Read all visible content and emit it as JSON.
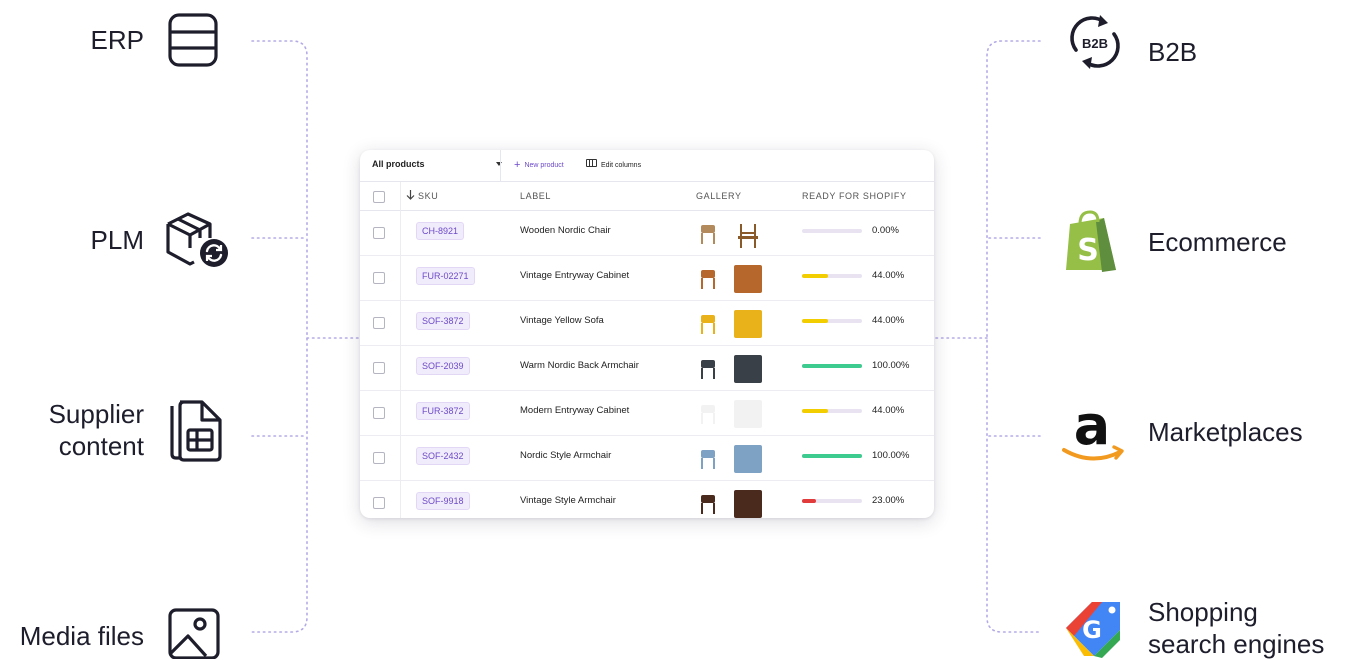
{
  "sources": [
    {
      "id": "erp",
      "label": "ERP",
      "icon": "database-icon"
    },
    {
      "id": "plm",
      "label": "PLM",
      "icon": "box-sync-icon"
    },
    {
      "id": "supplier",
      "label": "Supplier content",
      "label_line1": "Supplier",
      "label_line2": "content",
      "icon": "document-table-icon"
    },
    {
      "id": "media",
      "label": "Media files",
      "icon": "image-icon"
    }
  ],
  "channels": [
    {
      "id": "b2b",
      "label": "B2B",
      "icon": "b2b-sync-icon"
    },
    {
      "id": "ecommerce",
      "label": "Ecommerce",
      "icon": "shopify-icon"
    },
    {
      "id": "marketplaces",
      "label": "Marketplaces",
      "icon": "amazon-icon"
    },
    {
      "id": "shopping",
      "label": "Shopping search engines",
      "label_line1": "Shopping",
      "label_line2": "search engines",
      "icon": "google-shopping-icon"
    }
  ],
  "table": {
    "view_select": "All products",
    "new_product": "New product",
    "edit_columns": "Edit columns",
    "headers": {
      "sku": "SKU",
      "label": "LABEL",
      "gallery": "GALLERY",
      "ready": "READY FOR SHOPIFY"
    },
    "rows": [
      {
        "sku": "CH-8921",
        "label": "Wooden Nordic Chair",
        "ready": "0.00%",
        "ready_value": 0,
        "bar_color": "#e9e3f1",
        "thumb_color": "#efe6d9"
      },
      {
        "sku": "FUR-02271",
        "label": "Vintage Entryway Cabinet",
        "ready": "44.00%",
        "ready_value": 0.44,
        "bar_color": "#f2cd00",
        "thumb_color": "#b5672c"
      },
      {
        "sku": "SOF-3872",
        "label": "Vintage Yellow Sofa",
        "ready": "44.00%",
        "ready_value": 0.44,
        "bar_color": "#f2cd00",
        "thumb_color": "#e9b21b"
      },
      {
        "sku": "SOF-2039",
        "label": "Warm Nordic Back Armchair",
        "ready": "100.00%",
        "ready_value": 1.0,
        "bar_color": "#3dcb90",
        "thumb_color": "#3a4047"
      },
      {
        "sku": "FUR-3872",
        "label": "Modern Entryway Cabinet",
        "ready": "44.00%",
        "ready_value": 0.44,
        "bar_color": "#f2cd00",
        "thumb_color": "#f2f2f2"
      },
      {
        "sku": "SOF-2432",
        "label": "Nordic Style Armchair",
        "ready": "100.00%",
        "ready_value": 1.0,
        "bar_color": "#3dcb90",
        "thumb_color": "#7ea2c4"
      },
      {
        "sku": "SOF-9918",
        "label": "Vintage Style Armchair",
        "ready": "23.00%",
        "ready_value": 0.23,
        "bar_color": "#e23b3b",
        "thumb_color": "#4b2a1e"
      }
    ]
  },
  "colors": {
    "accent": "#6c4ac8",
    "connector": "#b3abe6",
    "shopify": "#95bf47",
    "amazon_smile": "#f29a1f"
  }
}
